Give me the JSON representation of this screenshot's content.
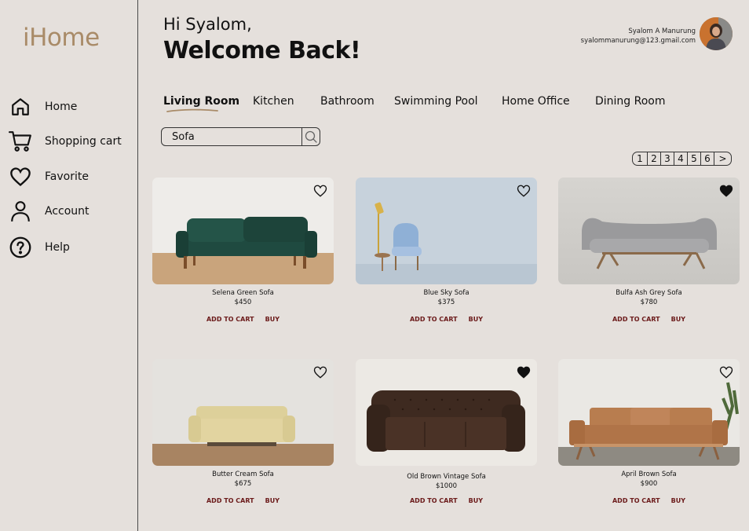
{
  "app": {
    "logo": "iHome"
  },
  "sidebar": {
    "items": [
      {
        "label": "Home",
        "icon": "home-icon"
      },
      {
        "label": "Shopping cart",
        "icon": "cart-icon"
      },
      {
        "label": "Favorite",
        "icon": "heart-icon"
      },
      {
        "label": "Account",
        "icon": "user-icon"
      },
      {
        "label": "Help",
        "icon": "help-icon"
      }
    ]
  },
  "header": {
    "greeting": "Hi Syalom,",
    "welcome": "Welcome Back!",
    "user_name": "Syalom A Manurung",
    "user_email": "syalommanurung@123.gmail.com"
  },
  "tabs": [
    {
      "label": "Living Room",
      "active": true
    },
    {
      "label": "Kitchen",
      "active": false
    },
    {
      "label": "Bathroom",
      "active": false
    },
    {
      "label": "Swimming Pool",
      "active": false
    },
    {
      "label": "Home Office",
      "active": false
    },
    {
      "label": "Dining Room",
      "active": false
    }
  ],
  "search": {
    "value": "Sofa",
    "placeholder": ""
  },
  "pagination": {
    "pages": [
      "1",
      "2",
      "3",
      "4",
      "5",
      "6"
    ],
    "next": ">"
  },
  "products": [
    {
      "name": "Selena Green Sofa",
      "price": "$450",
      "favorite": false,
      "add_to_cart": "ADD TO CART",
      "buy": "BUY",
      "color": "#1f4a40"
    },
    {
      "name": "Blue Sky Sofa",
      "price": "$375",
      "favorite": false,
      "add_to_cart": "ADD TO CART",
      "buy": "BUY",
      "color": "#8fb0d6"
    },
    {
      "name": "Bulfa Ash Grey Sofa",
      "price": "$780",
      "favorite": true,
      "add_to_cart": "ADD TO CART",
      "buy": "BUY",
      "color": "#9a9a9c"
    },
    {
      "name": "Butter Cream Sofa",
      "price": "$675",
      "favorite": false,
      "add_to_cart": "ADD TO CART",
      "buy": "BUY",
      "color": "#e2d4a0"
    },
    {
      "name": "Old Brown Vintage Sofa",
      "price": "$1000",
      "favorite": true,
      "add_to_cart": "ADD TO CART",
      "buy": "BUY",
      "color": "#3e2a20"
    },
    {
      "name": "April Brown Sofa",
      "price": "$900",
      "favorite": false,
      "add_to_cart": "ADD TO CART",
      "buy": "BUY",
      "color": "#b87d4f"
    }
  ],
  "colors": {
    "background": "#e5e0dc",
    "logo": "#a98b68",
    "action": "#6b1a1a",
    "underline": "#a98b68"
  }
}
